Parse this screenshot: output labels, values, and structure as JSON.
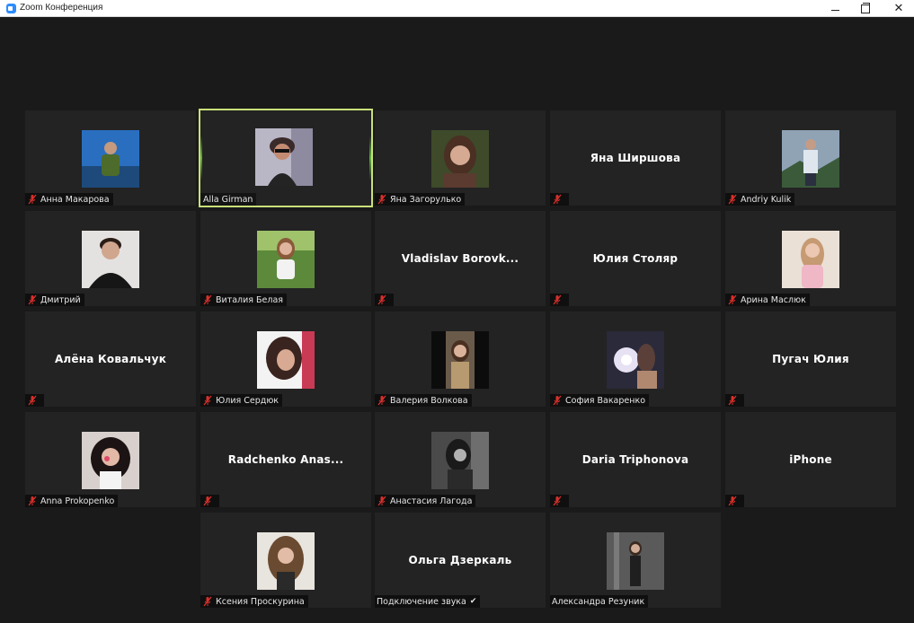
{
  "window": {
    "title": "Zoom Конференция",
    "min_label": "—",
    "close_label": "✕"
  },
  "colors": {
    "tile_bg": "#232323",
    "active_border": "#c9e07a",
    "mic_muted": "#d9302b"
  },
  "participants": [
    {
      "name": "Анна Макарова",
      "video": true,
      "muted": true
    },
    {
      "name": "Alla Girman",
      "video": true,
      "muted": false,
      "active": true
    },
    {
      "name": "Яна Загорулько",
      "video": true,
      "muted": true
    },
    {
      "name": "Яна Ширшова",
      "video": false,
      "muted": true
    },
    {
      "name": "Andriy Kulik",
      "video": true,
      "muted": true
    },
    {
      "name": "Дмитрий",
      "video": true,
      "muted": true
    },
    {
      "name": "Виталия Белая",
      "video": true,
      "muted": true
    },
    {
      "name": "Vladislav  Borovk...",
      "video": false,
      "muted": true
    },
    {
      "name": "Юлия Столяр",
      "video": false,
      "muted": true
    },
    {
      "name": "Арина Маслюк",
      "video": true,
      "muted": true
    },
    {
      "name": "Алёна Ковальчук",
      "video": false,
      "muted": true
    },
    {
      "name": "Юлия Сердюк",
      "video": true,
      "muted": true
    },
    {
      "name": "Валерия Волкова",
      "video": true,
      "muted": true
    },
    {
      "name": "София Вакаренко",
      "video": true,
      "muted": true
    },
    {
      "name": "Пугач Юлия",
      "video": false,
      "muted": true
    },
    {
      "name": "Anna Prokopenko",
      "video": true,
      "muted": true
    },
    {
      "name": "Radchenko  Anas...",
      "video": false,
      "muted": true
    },
    {
      "name": "Анастасия Лагода",
      "video": true,
      "muted": true
    },
    {
      "name": "Daria Triphonova",
      "video": false,
      "muted": true
    },
    {
      "name": "iPhone",
      "video": false,
      "muted": true
    },
    {
      "name": "Ксения Проскурина",
      "video": true,
      "muted": true
    },
    {
      "name": "Ольга Дзеркаль",
      "video": false,
      "muted": false,
      "status": "Подключение звука",
      "status_icon": "✔"
    },
    {
      "name": "Александра Резуник",
      "video": true,
      "muted": false
    }
  ]
}
